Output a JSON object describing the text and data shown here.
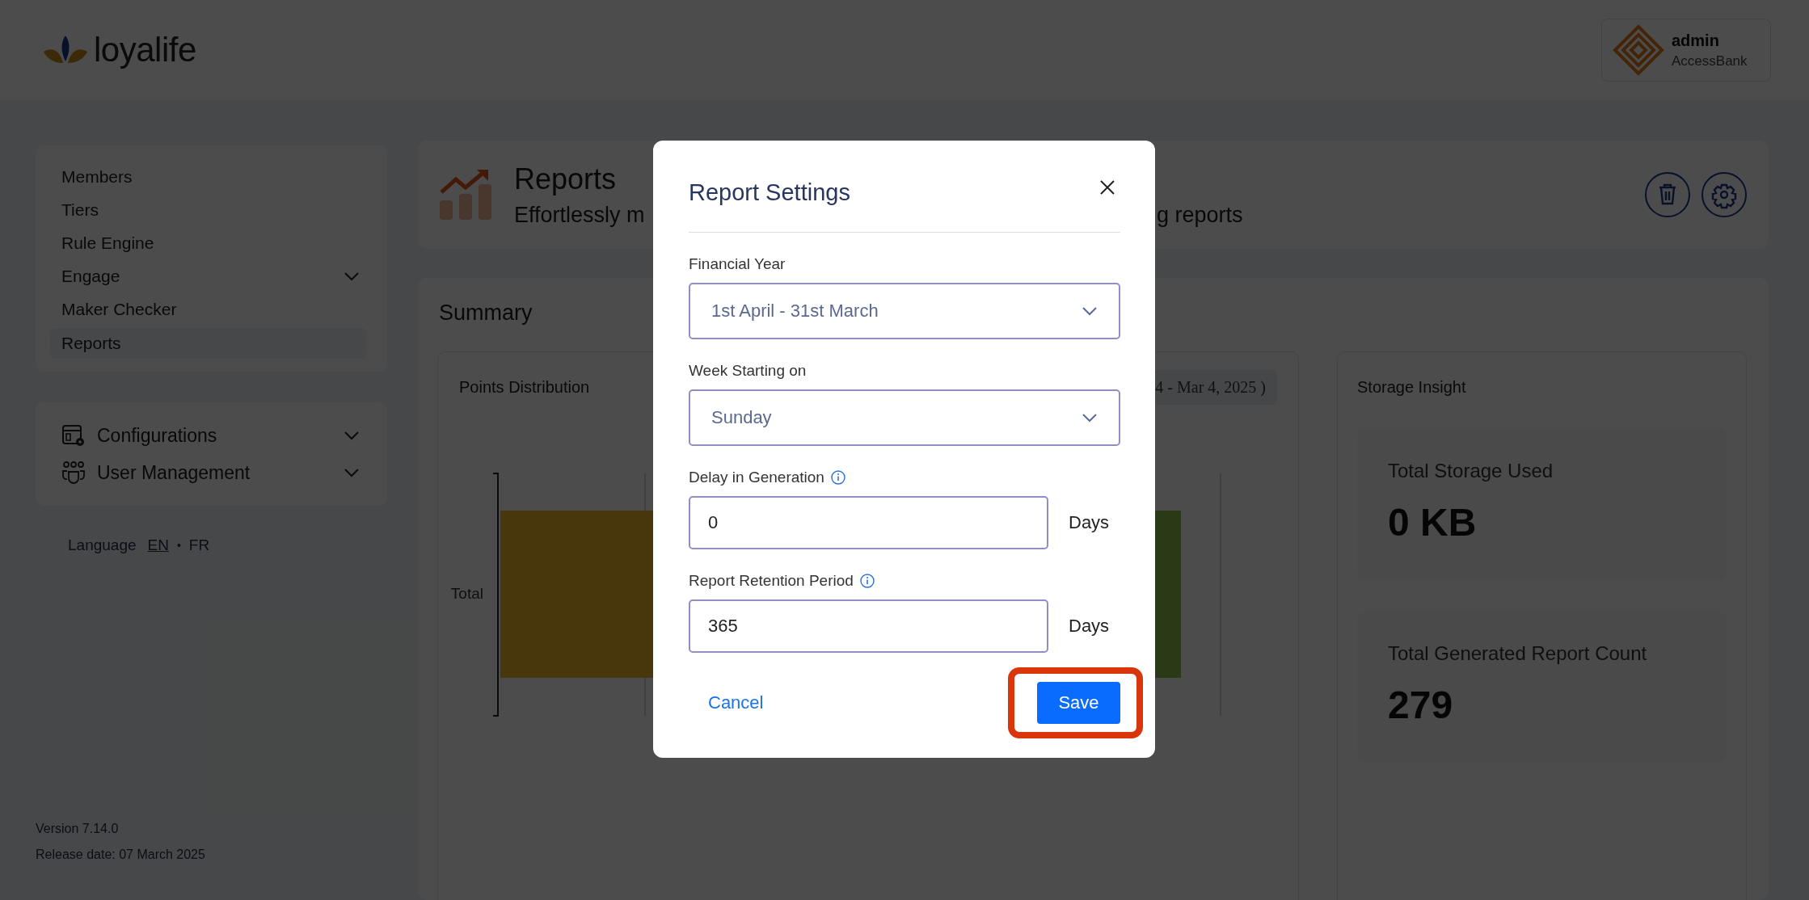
{
  "header": {
    "logo_text": "loyalife",
    "user": {
      "name": "admin",
      "organization": "AccessBank"
    }
  },
  "sidebar": {
    "menu": [
      {
        "label": "Members",
        "selected": false,
        "expandable": false
      },
      {
        "label": "Tiers",
        "selected": false,
        "expandable": false
      },
      {
        "label": "Rule Engine",
        "selected": false,
        "expandable": false
      },
      {
        "label": "Engage",
        "selected": false,
        "expandable": true
      },
      {
        "label": "Maker Checker",
        "selected": false,
        "expandable": false
      },
      {
        "label": "Reports",
        "selected": true,
        "expandable": false
      }
    ],
    "sections": [
      {
        "label": "Configurations",
        "kind": "config"
      },
      {
        "label": "User Management",
        "kind": "users"
      }
    ],
    "language": {
      "label": "Language",
      "separator": "•",
      "options": [
        {
          "label": "EN",
          "selected": true
        },
        {
          "label": "FR",
          "selected": false
        }
      ]
    },
    "version": "Version 7.14.0",
    "release_date": "Release date: 07 March 2025"
  },
  "page_header": {
    "title": "Reports",
    "subtitle_parts": [
      "Effortlessly m",
      "g reports"
    ]
  },
  "summary": {
    "title": "Summary",
    "points_card": {
      "title": "Points Distribution",
      "date_range": "4 - Mar 4, 2025 )",
      "axis_label": "Total"
    },
    "storage_card": {
      "title": "Storage Insight",
      "stats": [
        {
          "label": "Total Storage Used",
          "value": "0 KB"
        },
        {
          "label": "Total Generated Report Count",
          "value": "279"
        }
      ]
    }
  },
  "modal": {
    "title": "Report Settings",
    "fields": [
      {
        "kind": "select",
        "label": "Financial Year",
        "value": "1st April - 31st March"
      },
      {
        "kind": "select",
        "label": "Week Starting on",
        "value": "Sunday"
      },
      {
        "kind": "number",
        "label": "Delay in Generation",
        "info": true,
        "value": "0",
        "unit": "Days"
      },
      {
        "kind": "number",
        "label": "Report Retention Period",
        "info": true,
        "value": "365",
        "unit": "Days"
      }
    ],
    "cancel": "Cancel",
    "save": "Save",
    "save_highlighted": true
  }
}
